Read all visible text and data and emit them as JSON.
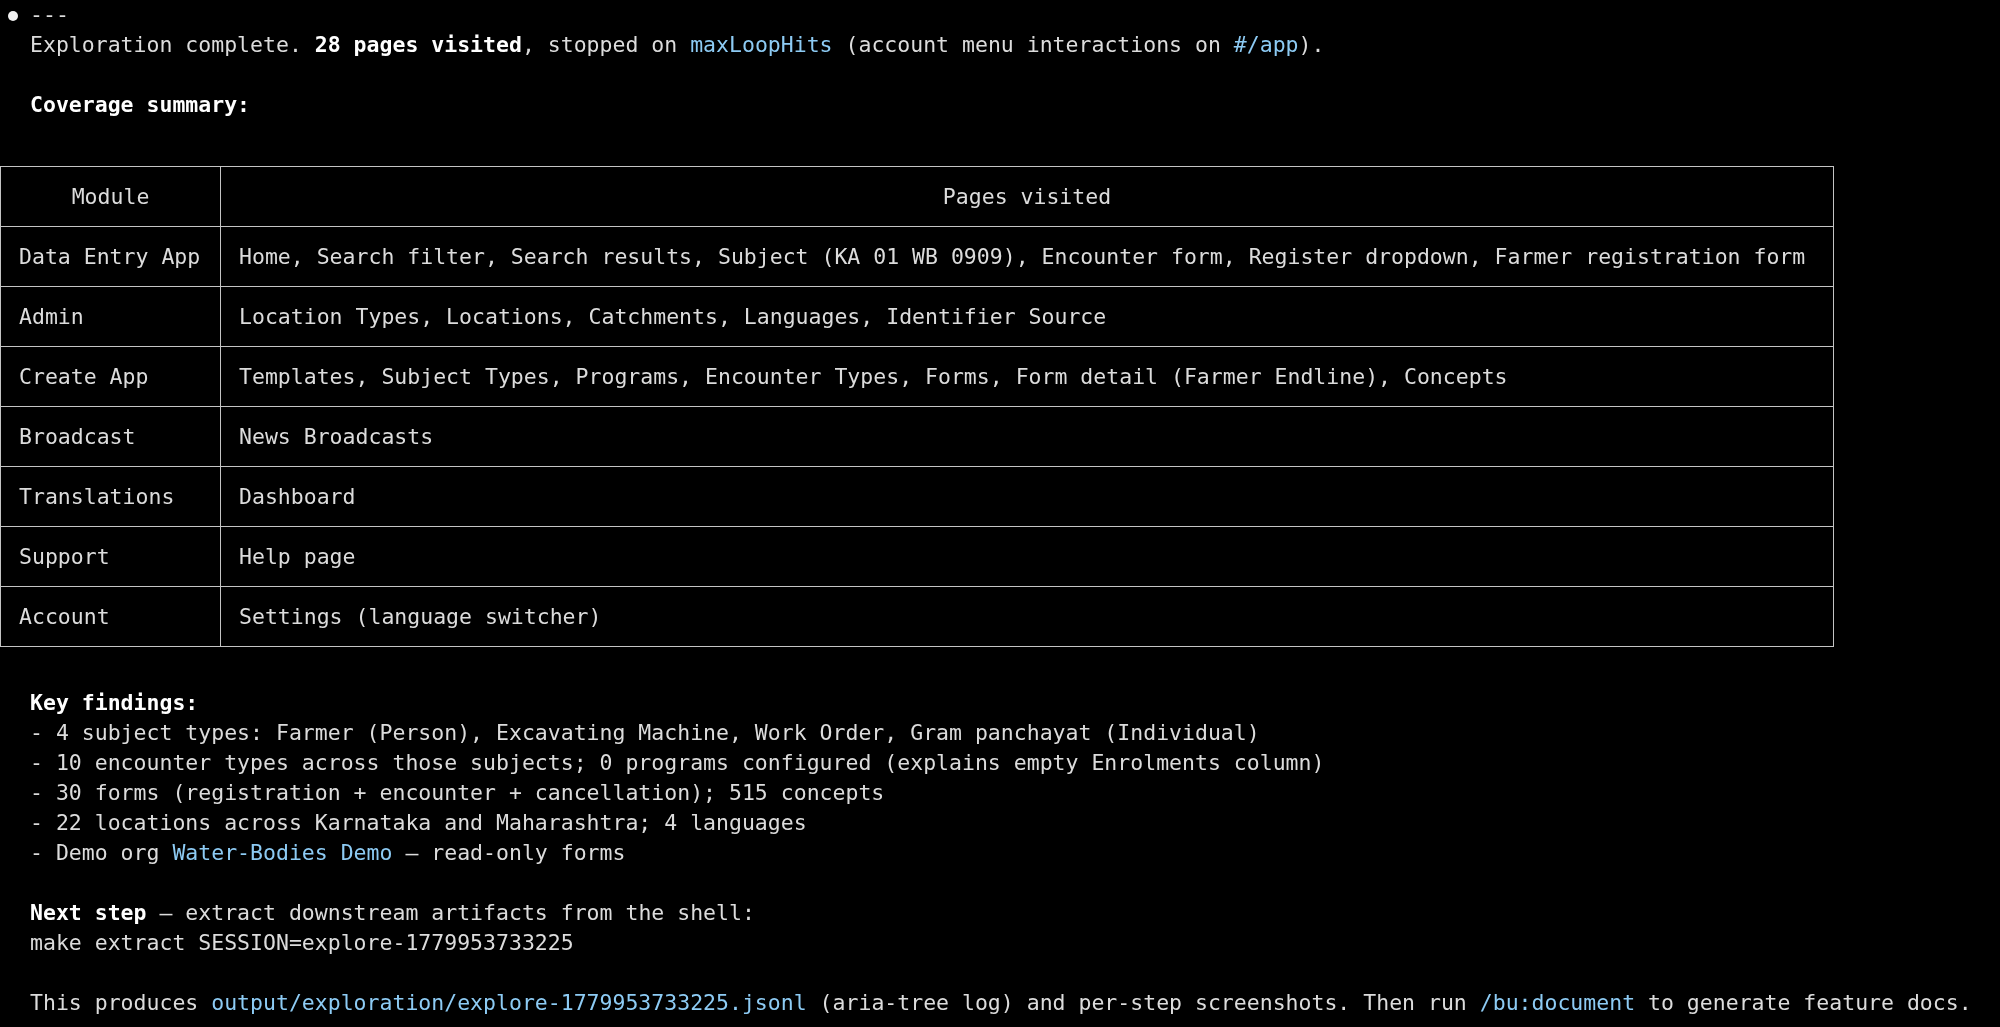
{
  "header_line": "---",
  "summary": [
    {
      "kind": "plain",
      "text": "Exploration complete. **28 pages visited**, stopped on "
    },
    {
      "kind": "link",
      "text": "maxLoopHits"
    },
    {
      "kind": "plain",
      "text": " (account menu interactions on "
    },
    {
      "kind": "link",
      "text": "#/app"
    },
    {
      "kind": "plain",
      "text": ")."
    }
  ],
  "coverage_heading": "Coverage summary:",
  "table": {
    "columns": [
      "Module",
      "Pages visited"
    ],
    "rows": [
      [
        "Data Entry App",
        "Home, Search filter, Search results, Subject (KA 01 WB 0909), Encounter form, Register dropdown, Farmer registration form"
      ],
      [
        "Admin",
        "Location Types, Locations, Catchments, Languages, Identifier Source"
      ],
      [
        "Create App",
        "Templates, Subject Types, Programs, Encounter Types, Forms, Form detail (Farmer Endline), Concepts"
      ],
      [
        "Broadcast",
        "News Broadcasts"
      ],
      [
        "Translations",
        "Dashboard"
      ],
      [
        "Support",
        "Help page"
      ],
      [
        "Account",
        "Settings (language switcher)"
      ]
    ]
  },
  "findings_heading": "Key findings:",
  "findings": [
    [
      {
        "kind": "plain",
        "text": "- 4 subject types: Farmer (Person), Excavating Machine, Work Order, Gram panchayat (Individual)"
      }
    ],
    [
      {
        "kind": "plain",
        "text": "- 10 encounter types across those subjects; 0 programs configured (explains empty Enrolments column)"
      }
    ],
    [
      {
        "kind": "plain",
        "text": "- 30 forms (registration + encounter + cancellation); 515 concepts"
      }
    ],
    [
      {
        "kind": "plain",
        "text": "- 22 locations across Karnataka and Maharashtra; 4 languages"
      }
    ],
    [
      {
        "kind": "plain",
        "text": "- Demo org "
      },
      {
        "kind": "link",
        "text": "Water-Bodies Demo"
      },
      {
        "kind": "plain",
        "text": " — read-only forms"
      }
    ]
  ],
  "next_step": [
    {
      "kind": "plain",
      "text": "**Next step** — extract downstream artifacts from the shell:"
    }
  ],
  "command": "make extract SESSION=explore-1779953733225",
  "closing": [
    {
      "kind": "plain",
      "text": "This produces "
    },
    {
      "kind": "link",
      "text": "output/exploration/explore-1779953733225.jsonl"
    },
    {
      "kind": "plain",
      "text": " (aria-tree log) and per-step screenshots. Then run "
    },
    {
      "kind": "link",
      "text": "/bu:document"
    },
    {
      "kind": "plain",
      "text": " to generate feature docs."
    }
  ]
}
